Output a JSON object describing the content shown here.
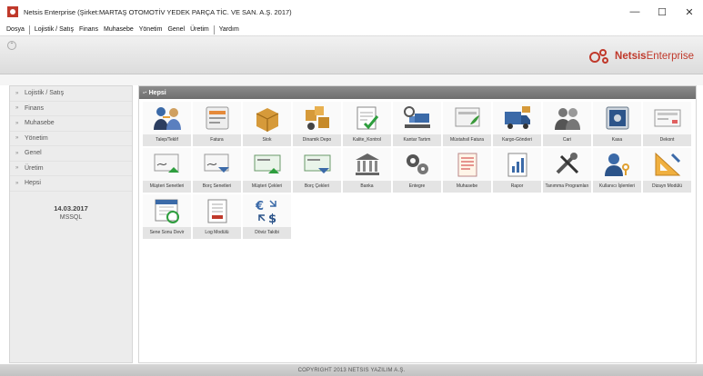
{
  "window": {
    "title": "Netsis Enterprise (Şirket:MARTAŞ OTOMOTİV YEDEK PARÇA TİC. VE SAN. A.Ş. 2017)",
    "minimize": "—",
    "maximize": "☐",
    "close": "✕"
  },
  "menu": [
    "Dosya",
    "Lojistik / Satış",
    "Finans",
    "Muhasebe",
    "Yönetim",
    "Genel",
    "Üretim",
    "Yardım"
  ],
  "brand": {
    "bold": "Netsis",
    "light": "Enterprise"
  },
  "sidebar": {
    "items": [
      "Lojistik / Satış",
      "Finans",
      "Muhasebe",
      "Yönetim",
      "Genel",
      "Üretim",
      "Hepsi"
    ],
    "date": "14.03.2017",
    "db": "MSSQL"
  },
  "group": {
    "title": "Hepsi"
  },
  "tiles": [
    {
      "label": "Talep/Teklif",
      "icon": "people-exchange-icon"
    },
    {
      "label": "Fatura",
      "icon": "invoice-icon"
    },
    {
      "label": "Stok",
      "icon": "stock-box-icon"
    },
    {
      "label": "Dinamik Depo",
      "icon": "dynamic-warehouse-icon"
    },
    {
      "label": "Kalite_Kontrol",
      "icon": "quality-check-icon"
    },
    {
      "label": "Kantar Tartım",
      "icon": "weighbridge-icon"
    },
    {
      "label": "Müstahsil Fatura",
      "icon": "producer-invoice-icon"
    },
    {
      "label": "Kargo-Gönderi",
      "icon": "cargo-truck-icon"
    },
    {
      "label": "Cari",
      "icon": "accounts-people-icon"
    },
    {
      "label": "Kasa",
      "icon": "safe-icon"
    },
    {
      "label": "Dekont",
      "icon": "voucher-icon"
    },
    {
      "label": "Müşteri Senetleri",
      "icon": "customer-notes-icon"
    },
    {
      "label": "Borç Senetleri",
      "icon": "debt-notes-icon"
    },
    {
      "label": "Müşteri Çekleri",
      "icon": "customer-checks-icon"
    },
    {
      "label": "Borç Çekleri",
      "icon": "debt-checks-icon"
    },
    {
      "label": "Banka",
      "icon": "bank-icon"
    },
    {
      "label": "Entegre",
      "icon": "integration-gears-icon"
    },
    {
      "label": "Muhasebe",
      "icon": "ledger-icon"
    },
    {
      "label": "Rapor",
      "icon": "report-chart-icon"
    },
    {
      "label": "Tanımma Programları",
      "icon": "tools-icon"
    },
    {
      "label": "Kullanıcı İşlemleri",
      "icon": "user-key-icon"
    },
    {
      "label": "Dizayn Modülü",
      "icon": "design-ruler-icon"
    },
    {
      "label": "Sene Sonu Devir",
      "icon": "year-end-calendar-icon"
    },
    {
      "label": "Log Modülü",
      "icon": "log-document-icon"
    },
    {
      "label": "Döviz Takibi",
      "icon": "currency-exchange-icon"
    }
  ],
  "status": {
    "copyright": "COPYRIGHT 2013 NETSIS YAZILIM A.Ş."
  },
  "colors": {
    "brand": "#c0392b",
    "header": "#7a7a7a",
    "sidebar_bg": "#ececec"
  }
}
